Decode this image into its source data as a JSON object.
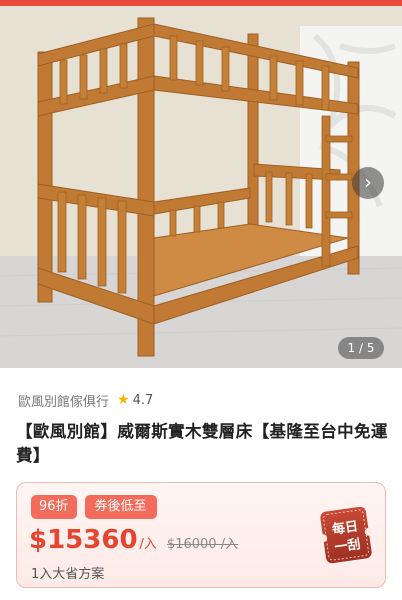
{
  "gallery": {
    "counter": "1 / 5",
    "icons": {
      "next": "chevron-right-icon"
    }
  },
  "seller": {
    "name": "歐風別館傢俱行",
    "rating": "4.7",
    "icons": {
      "rating": "star-icon"
    }
  },
  "product": {
    "title": "【歐風別館】威爾斯實木雙層床【基隆至台中免運費】"
  },
  "pricing": {
    "discount_badge": "96折",
    "coupon_badge": "券後低至",
    "price": "$15360",
    "unit": "/入",
    "original_price": "$16000 /入",
    "plan_text": "1入大省方案",
    "promo_tag_line1": "每日",
    "promo_tag_line2": "一刮",
    "colors": {
      "accent": "#e8432f",
      "badge": "#f26b5b",
      "card_bg": "#fdeae7",
      "tag": "#b83a2a"
    }
  }
}
